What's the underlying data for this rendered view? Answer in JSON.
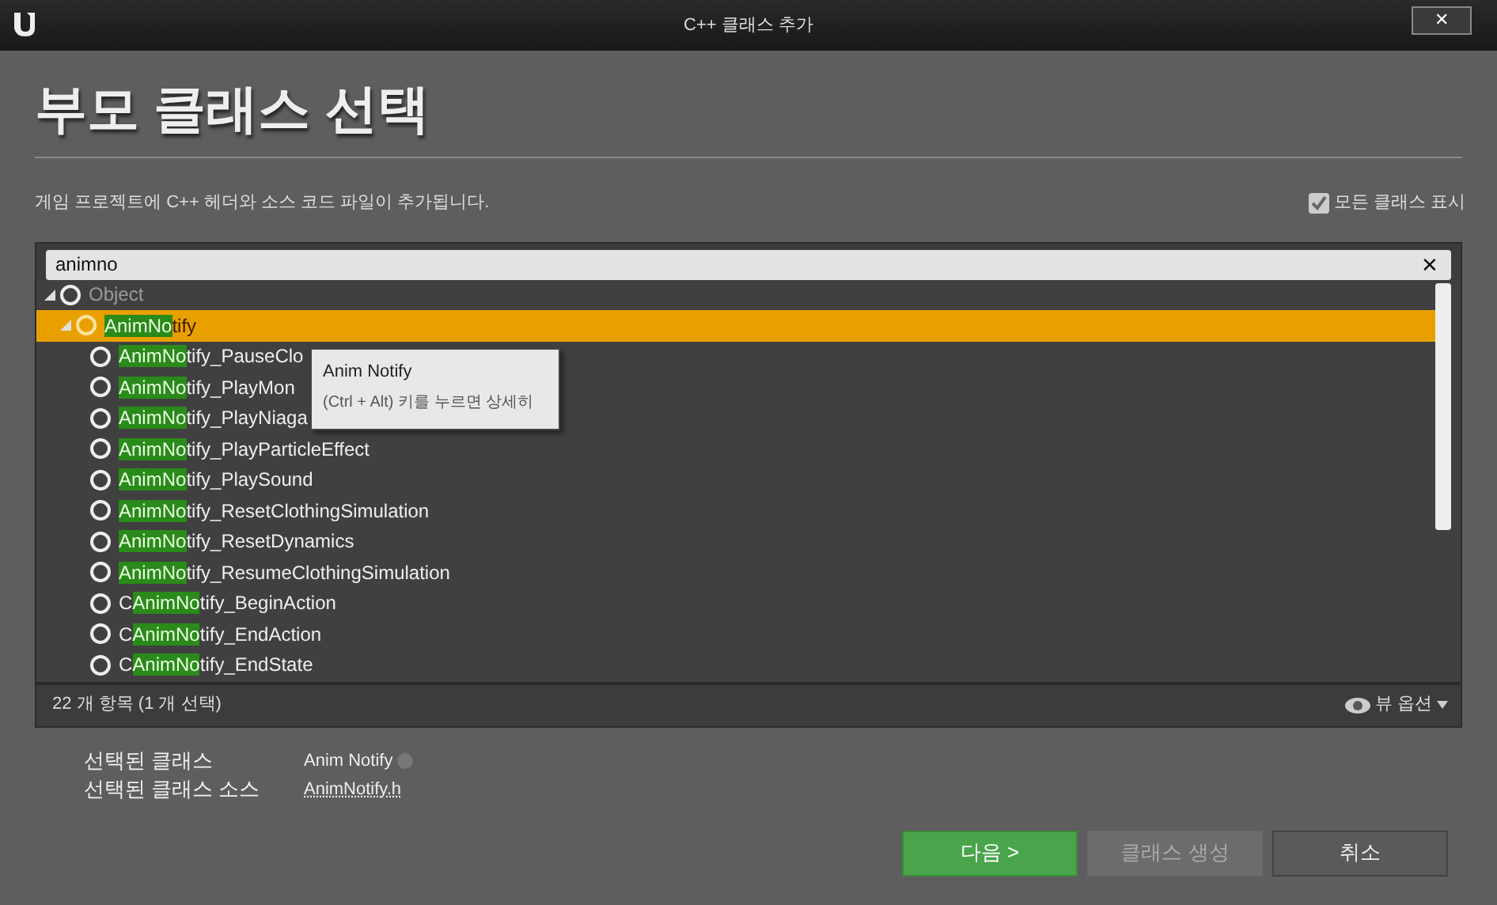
{
  "window": {
    "title": "C++ 클래스 추가",
    "close": "✕"
  },
  "heading": "부모 클래스 선택",
  "description": "게임 프로젝트에 C++ 헤더와 소스 코드 파일이 추가됩니다.",
  "show_all_classes": {
    "label": "모든 클래스 표시",
    "checked": true
  },
  "search": {
    "value": "animno",
    "clear": "✕"
  },
  "tree": [
    {
      "name": "Object",
      "expanded": true,
      "selected": false,
      "children": [
        {
          "name": "**AnimNo**tify",
          "expanded": true,
          "selected": true,
          "children": [
            {
              "name": "**AnimNo**tify_PauseClo",
              "selected": false
            },
            {
              "name": "**AnimNo**tify_PlayMon",
              "selected": false
            },
            {
              "name": "**AnimNo**tify_PlayNiaga",
              "selected": false
            },
            {
              "name": "**AnimNo**tify_PlayParticleEffect",
              "selected": false
            },
            {
              "name": "**AnimNo**tify_PlaySound",
              "selected": false
            },
            {
              "name": "**AnimNo**tify_ResetClothingSimulation",
              "selected": false
            },
            {
              "name": "**AnimNo**tify_ResetDynamics",
              "selected": false
            },
            {
              "name": "**AnimNo**tify_ResumeClothingSimulation",
              "selected": false
            },
            {
              "name": "C**AnimNo**tify_BeginAction",
              "selected": false
            },
            {
              "name": "C**AnimNo**tify_EndAction",
              "selected": false
            },
            {
              "name": "C**AnimNo**tify_EndState",
              "selected": false
            }
          ]
        }
      ]
    }
  ],
  "tooltip": {
    "title": "Anim Notify",
    "hint": "(Ctrl + Alt) 키를 누르면 상세히"
  },
  "status": "22 개 항목 (1 개 선택)",
  "view_options": "뷰 옵션",
  "selected_class": {
    "label": "선택된 클래스",
    "value": "Anim Notify"
  },
  "selected_source": {
    "label": "선택된 클래스 소스",
    "value": "AnimNotify.h"
  },
  "buttons": [
    {
      "label": "다음 >",
      "kind": "primary",
      "disabled": false
    },
    {
      "label": "클래스 생성",
      "kind": "secondary",
      "disabled": true
    },
    {
      "label": "취소",
      "kind": "secondary",
      "disabled": false
    }
  ]
}
